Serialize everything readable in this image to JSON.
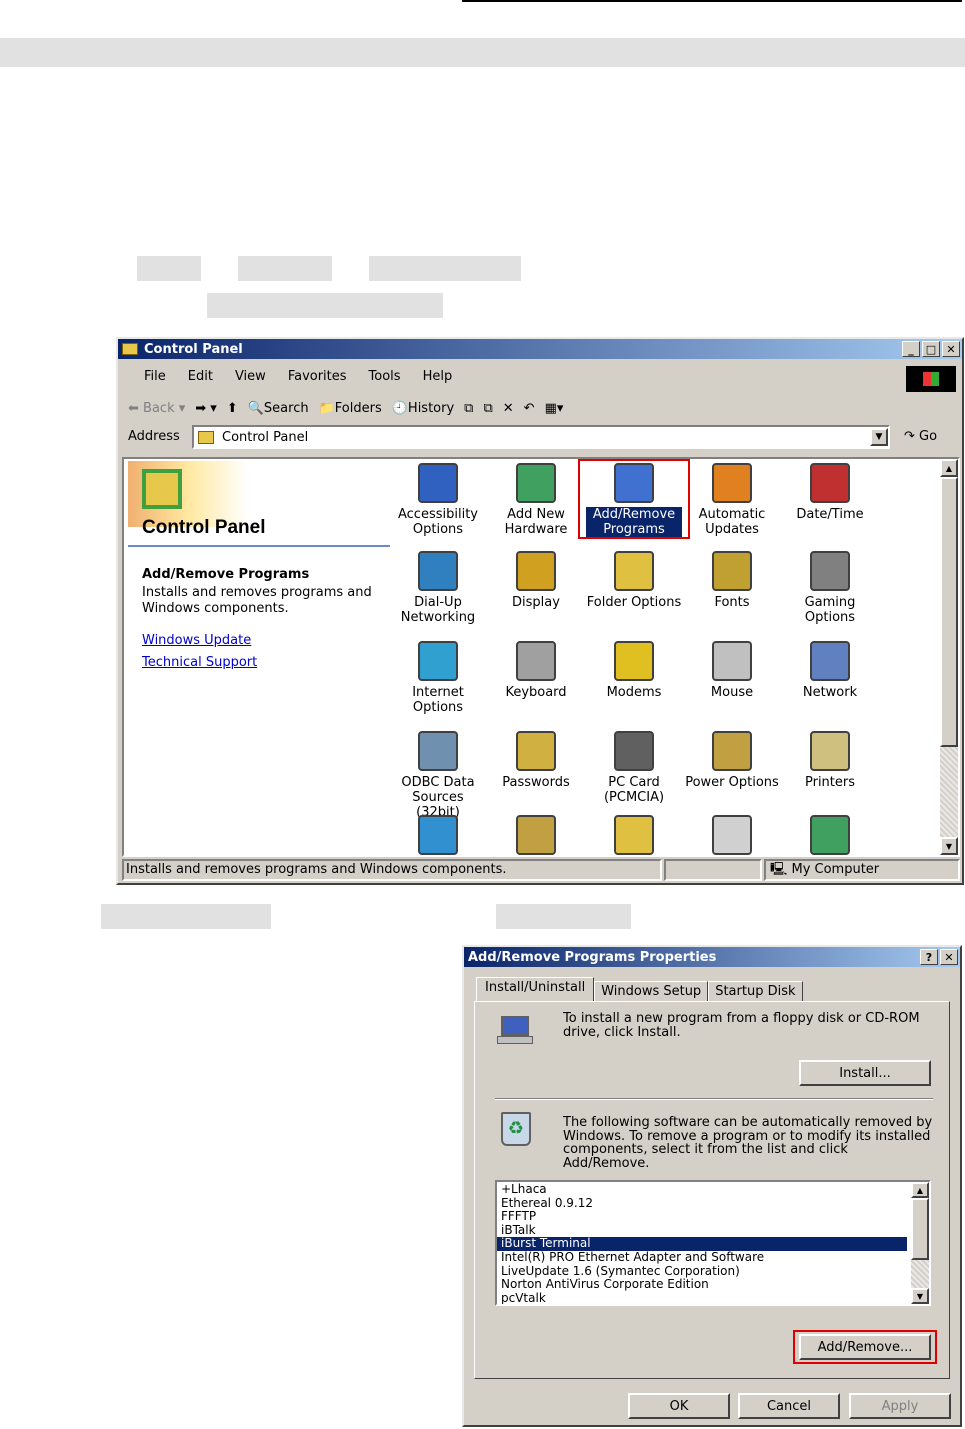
{
  "control_panel": {
    "title": "Control Panel",
    "menu": [
      "File",
      "Edit",
      "View",
      "Favorites",
      "Tools",
      "Help"
    ],
    "toolbar": {
      "back": "Back",
      "search": "Search",
      "folders": "Folders",
      "history": "History"
    },
    "address_label": "Address",
    "address_value": "Control Panel",
    "go": "Go",
    "panel_heading": "Control Panel",
    "info_title": "Add/Remove Programs",
    "info_desc": "Installs and removes programs and Windows components.",
    "links": [
      "Windows Update",
      "Technical Support"
    ],
    "icons": [
      [
        "Accessibility",
        "Options"
      ],
      [
        "Add New",
        "Hardware"
      ],
      [
        "Add/Remove",
        "Programs"
      ],
      [
        "Automatic",
        "Updates"
      ],
      [
        "Date/Time",
        ""
      ],
      [
        "Dial-Up",
        "Networking"
      ],
      [
        "Display",
        ""
      ],
      [
        "Folder Options",
        ""
      ],
      [
        "Fonts",
        ""
      ],
      [
        "Gaming",
        "Options"
      ],
      [
        "Internet",
        "Options"
      ],
      [
        "Keyboard",
        ""
      ],
      [
        "Modems",
        ""
      ],
      [
        "Mouse",
        ""
      ],
      [
        "Network",
        ""
      ],
      [
        "ODBC Data",
        "Sources (32bit)"
      ],
      [
        "Passwords",
        ""
      ],
      [
        "PC Card",
        "(PCMCIA)"
      ],
      [
        "Power Options",
        ""
      ],
      [
        "Printers",
        ""
      ]
    ],
    "status": "Installs and removes programs and Windows components.",
    "status_zone": "My Computer"
  },
  "addremove": {
    "title": "Add/Remove Programs Properties",
    "tabs": [
      "Install/Uninstall",
      "Windows Setup",
      "Startup Disk"
    ],
    "install_text": "To install a new program from a floppy disk or CD-ROM drive, click Install.",
    "install_button": "Install...",
    "remove_text": "The following software can be automatically removed by Windows. To remove a program or to modify its installed components, select it from the list and click Add/Remove.",
    "programs": [
      "+Lhaca",
      "Ethereal 0.9.12",
      "FFFTP",
      "iBTalk",
      "iBurst Terminal",
      "Intel(R) PRO Ethernet Adapter and Software",
      "LiveUpdate 1.6 (Symantec Corporation)",
      "Norton AntiVirus Corporate Edition",
      "pcVtalk"
    ],
    "selected_index": 4,
    "addremove_button": "Add/Remove...",
    "ok": "OK",
    "cancel": "Cancel",
    "apply": "Apply"
  }
}
